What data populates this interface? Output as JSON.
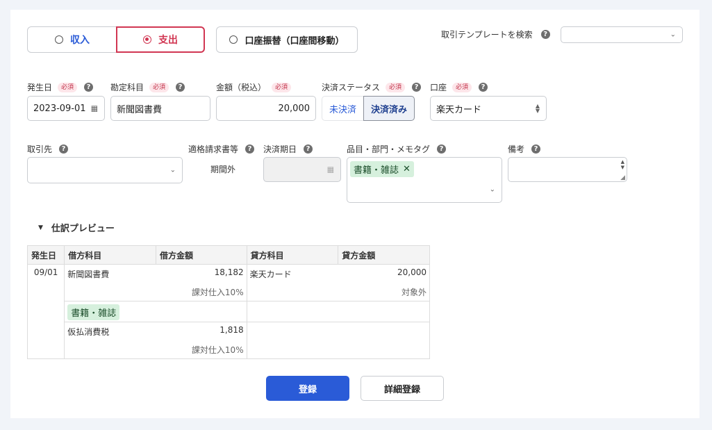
{
  "tx_type": {
    "income_label": "収入",
    "expense_label": "支出",
    "transfer_label": "口座振替（口座間移動）",
    "selected": "支出"
  },
  "template_search": {
    "label": "取引テンプレートを検索",
    "value": ""
  },
  "required_badge": "必須",
  "help_glyph": "?",
  "fields": {
    "date_label": "発生日",
    "date_value": "2023-09-01",
    "account_label": "勘定科目",
    "account_value": "新聞図書費",
    "amount_label": "金額（税込）",
    "amount_value": "20,000",
    "status_label": "決済ステータス",
    "status_options": [
      "未決済",
      "決済済み"
    ],
    "status_selected": "決済済み",
    "wallet_label": "口座",
    "wallet_value": "楽天カード",
    "partner_label": "取引先",
    "partner_value": "",
    "invoice_label": "適格請求書等",
    "invoice_value": "期間外",
    "due_label": "決済期日",
    "due_value": "",
    "tags_label": "品目・部門・メモタグ",
    "tags": [
      "書籍・雑誌"
    ],
    "memo_label": "備考",
    "memo_value": ""
  },
  "preview": {
    "title": "仕訳プレビュー",
    "headers": [
      "発生日",
      "借方科目",
      "借方金額",
      "貸方科目",
      "貸方金額"
    ],
    "date": "09/01",
    "debit_1_account": "新聞図書費",
    "debit_1_amount": "18,182",
    "debit_1_tax": "課対仕入10%",
    "debit_1_tag": "書籍・雑誌",
    "credit_1_account": "楽天カード",
    "credit_1_amount": "20,000",
    "credit_1_tax": "対象外",
    "debit_2_account": "仮払消費税",
    "debit_2_amount": "1,818",
    "debit_2_tax": "課対仕入10%"
  },
  "actions": {
    "submit_label": "登録",
    "detail_label": "詳細登録"
  },
  "colors": {
    "primary": "#2a5bd7",
    "expense": "#d13652",
    "income": "#2a5bd7",
    "tag_bg": "#d6f0dd"
  }
}
